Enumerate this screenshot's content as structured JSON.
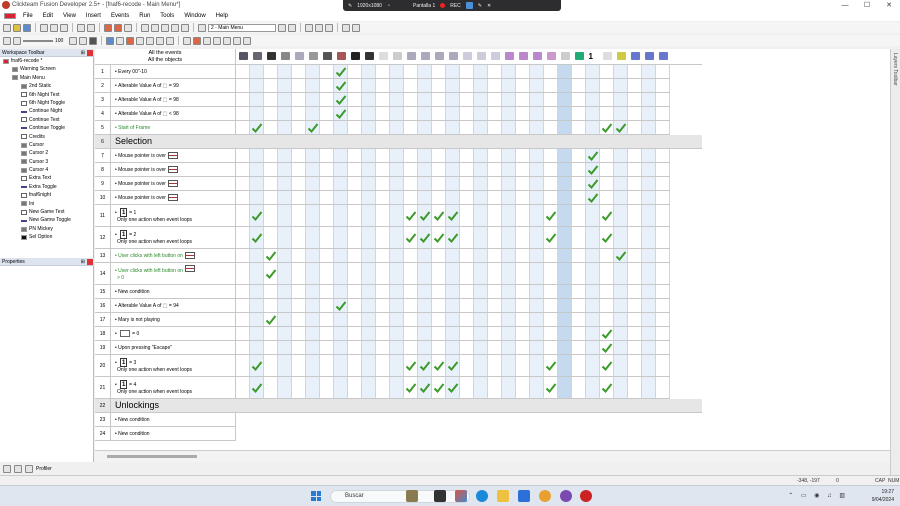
{
  "window": {
    "title": "Clickteam Fusion Developer 2.5+ - [fnaf6-recode - Main Menu*]",
    "controls": [
      "—",
      "☐",
      "✕"
    ]
  },
  "recording_bar": {
    "resolution": "1920x1080",
    "screen": "Pantalla 1",
    "rec_label": "REC"
  },
  "menu": [
    "File",
    "Edit",
    "View",
    "Insert",
    "Events",
    "Run",
    "Tools",
    "Window",
    "Help"
  ],
  "toolbar": {
    "frame_select": "2 - Main Menu",
    "zoom": "100"
  },
  "workspace": {
    "title": "Workspace Toolbar",
    "items": [
      {
        "label": "fnaf6-recode *",
        "indent": 0,
        "icon": "frame"
      },
      {
        "label": "Warning Screen",
        "indent": 1,
        "icon": "act"
      },
      {
        "label": "Main Menu",
        "indent": 1,
        "icon": "act"
      },
      {
        "label": "2nd Static",
        "indent": 2,
        "icon": "act"
      },
      {
        "label": "6th Night Text",
        "indent": 2,
        "icon": "txt"
      },
      {
        "label": "6th Night Toggle",
        "indent": 2,
        "icon": "txt"
      },
      {
        "label": "Continue Night",
        "indent": 2,
        "icon": "line"
      },
      {
        "label": "Continue Text",
        "indent": 2,
        "icon": "txt"
      },
      {
        "label": "Continue Toggle",
        "indent": 2,
        "icon": "line"
      },
      {
        "label": "Credits",
        "indent": 2,
        "icon": "txt"
      },
      {
        "label": "Cursor",
        "indent": 2,
        "icon": "act"
      },
      {
        "label": "Cursor 2",
        "indent": 2,
        "icon": "act"
      },
      {
        "label": "Cursor 3",
        "indent": 2,
        "icon": "act"
      },
      {
        "label": "Cursor 4",
        "indent": 2,
        "icon": "act"
      },
      {
        "label": "Extra Text",
        "indent": 2,
        "icon": "txt"
      },
      {
        "label": "Extra Toggle",
        "indent": 2,
        "icon": "line"
      },
      {
        "label": "fnaf6night",
        "indent": 2,
        "icon": "txt"
      },
      {
        "label": "Ini",
        "indent": 2,
        "icon": "act"
      },
      {
        "label": "New Game Text",
        "indent": 2,
        "icon": "txt"
      },
      {
        "label": "New Gamw Toggle",
        "indent": 2,
        "icon": "line"
      },
      {
        "label": "PN Mickey",
        "indent": 2,
        "icon": "act"
      },
      {
        "label": "Sel Option",
        "indent": 2,
        "icon": "cnt"
      }
    ]
  },
  "properties": {
    "title": "Properties",
    "footer": "Profiler"
  },
  "right_rail": {
    "label": "Layers Toolbar"
  },
  "grid": {
    "header_line1": "All the events",
    "header_line2": "All the objects",
    "top_counter": "1",
    "columns": 31,
    "rows": [
      {
        "num": "1",
        "text": "Every 00\"-10",
        "checks": [
          7
        ]
      },
      {
        "num": "2",
        "text": "Alterable Value A of ⬚ = 99",
        "checks": [
          7
        ]
      },
      {
        "num": "3",
        "text": "Alterable Value A of ⬚ = 98",
        "checks": [
          7
        ]
      },
      {
        "num": "4",
        "text": "Alterable Value A of ⬚ < 98",
        "checks": [
          7
        ]
      },
      {
        "num": "5",
        "text": "Start of Frame",
        "green": true,
        "checks": [
          1,
          5,
          26,
          27
        ]
      },
      {
        "num": "6",
        "text": "Selection",
        "group": true
      },
      {
        "num": "7",
        "text": "Mouse pointer is over",
        "pad": true,
        "checks": [
          25
        ]
      },
      {
        "num": "8",
        "text": "Mouse pointer is over",
        "pad": true,
        "checks": [
          25
        ]
      },
      {
        "num": "9",
        "text": "Mouse pointer is over",
        "pad": true,
        "checks": [
          25
        ]
      },
      {
        "num": "10",
        "text": "Mouse pointer is over",
        "pad": true,
        "checks": [
          25
        ]
      },
      {
        "num": "11",
        "text": "= 1",
        "sub": "Only one action when event loops",
        "tall": true,
        "checks": [
          1,
          12,
          13,
          14,
          15,
          22,
          26
        ]
      },
      {
        "num": "12",
        "text": "= 2",
        "sub": "Only one action when event loops",
        "tall": true,
        "checks": [
          1,
          12,
          13,
          14,
          15,
          22,
          26
        ]
      },
      {
        "num": "13",
        "text": "User clicks with left button on",
        "green": true,
        "pad": true,
        "checks": [
          2,
          27
        ]
      },
      {
        "num": "14",
        "text": "User clicks with left button on",
        "green": true,
        "pad": true,
        "sub": "> 0",
        "tall": true,
        "checks": [
          2
        ]
      },
      {
        "num": "15",
        "text": "New condition",
        "checks": []
      },
      {
        "num": "16",
        "text": "Alterable Value A of ⬚ = 94",
        "checks": [
          7
        ]
      },
      {
        "num": "17",
        "text": "Mary is not playing",
        "checks": [
          2
        ]
      },
      {
        "num": "18",
        "text": "= 0",
        "checks": [
          26
        ]
      },
      {
        "num": "19",
        "text": "Upon pressing \"Escape\"",
        "checks": [
          26
        ]
      },
      {
        "num": "20",
        "text": "= 3",
        "sub": "Only one action when event loops",
        "tall": true,
        "checks": [
          1,
          12,
          13,
          14,
          15,
          22,
          26
        ]
      },
      {
        "num": "21",
        "text": "= 4",
        "sub": "Only one action when event loops",
        "tall": true,
        "checks": [
          1,
          12,
          13,
          14,
          15,
          22,
          26
        ]
      },
      {
        "num": "22",
        "text": "Unlockings",
        "group": true
      },
      {
        "num": "23",
        "text": "New condition",
        "checks": []
      },
      {
        "num": "24",
        "text": "New condition",
        "checks": []
      }
    ]
  },
  "status": {
    "coords": "-348, -197",
    "zero": "0",
    "caps": "CAP",
    "num": "NUM"
  },
  "taskbar": {
    "search": "Buscar",
    "time": "19:27",
    "date": "9/04/2024"
  }
}
